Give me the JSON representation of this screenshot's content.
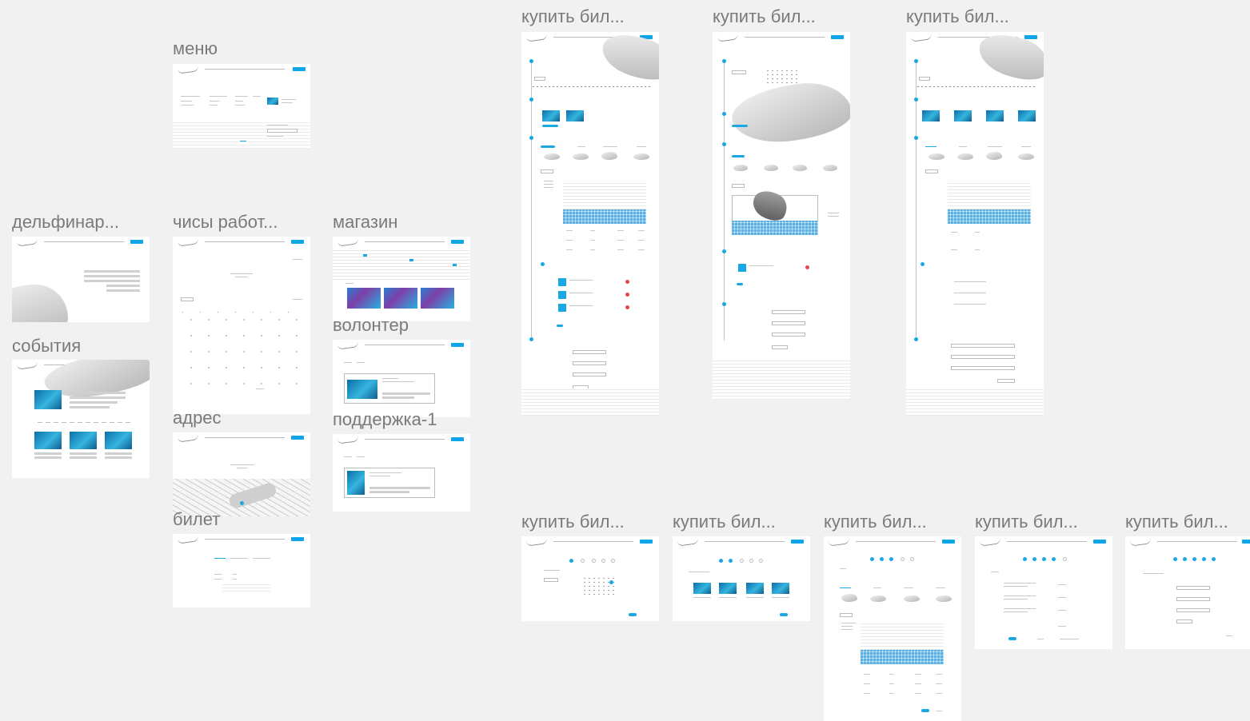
{
  "canvas": {
    "background": "#f1f1f1",
    "accent": "#1aa7e4"
  },
  "frames": {
    "menu": "меню",
    "dolphinarium": "дельфинар...",
    "events": "события",
    "hours": "чисы работ...",
    "address": "адрес",
    "ticket": "билет",
    "shop": "магазин",
    "volunteer": "волонтер",
    "support": "поддержка-1",
    "buy1": "купить бил...",
    "buy2": "купить бил...",
    "buy3": "купить бил...",
    "buy4": "купить бил...",
    "buy5": "купить бил...",
    "buy6": "купить бил...",
    "buy7": "купить бил...",
    "buy8": "купить бил..."
  },
  "icons": {
    "logo": "logo-icon",
    "dolphin": "dolphin-illustration",
    "map": "city-map"
  }
}
